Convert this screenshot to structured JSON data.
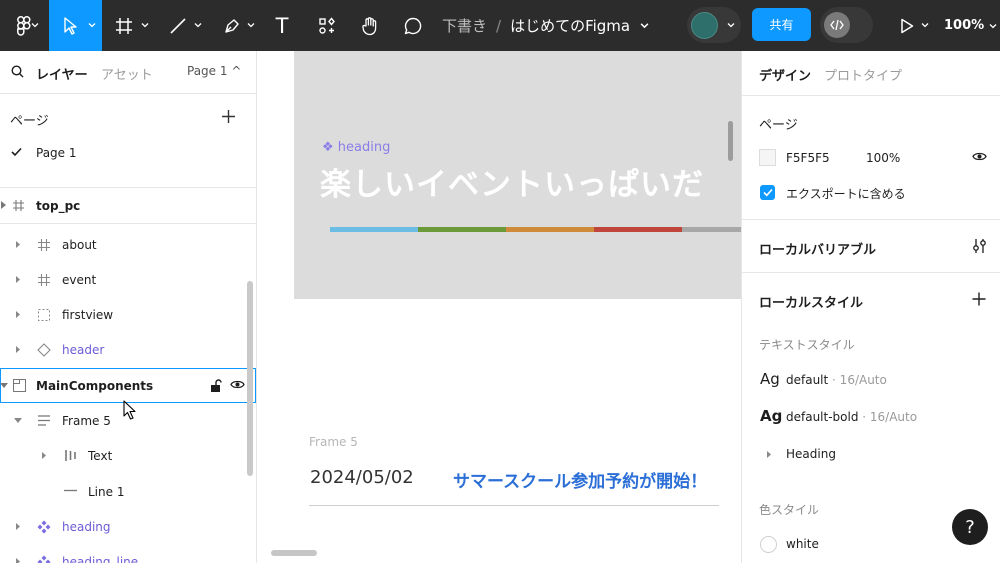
{
  "toolbar": {
    "breadcrumb_draft": "下書き",
    "breadcrumb_sep": "/",
    "file_name": "はじめてのFigma",
    "share_label": "共有",
    "zoom_label": "100%",
    "text_tool_glyph": "T"
  },
  "left_panel": {
    "tab_layers": "レイヤー",
    "tab_assets": "アセット",
    "page_select": "Page 1 ^",
    "pages_title": "ページ",
    "pages": [
      {
        "name": "Page 1"
      }
    ],
    "layers": [
      {
        "label": "top_pc"
      },
      {
        "label": "about"
      },
      {
        "label": "event"
      },
      {
        "label": "firstview"
      },
      {
        "label": "header"
      },
      {
        "label": "MainComponents"
      },
      {
        "label": "Frame 5"
      },
      {
        "label": "Text"
      },
      {
        "label": "Line 1"
      },
      {
        "label": "heading"
      },
      {
        "label": "heading_line"
      }
    ]
  },
  "canvas": {
    "hero_tag": "❖ heading",
    "hero_title": "楽しいイベントいっぱいだ",
    "hero_bar_colors": [
      "#6bbde3",
      "#6a9a3a",
      "#cf8a3a",
      "#c0453a",
      "#a8a8a8"
    ],
    "frame_label": "Frame 5",
    "news_date": "2024/05/02",
    "news_title": "サマースクール参加予約が開始！"
  },
  "right_panel": {
    "tab_design": "デザイン",
    "tab_prototype": "プロトタイプ",
    "page_heading": "ページ",
    "page_color_hex": "F5F5F5",
    "page_color_opacity": "100%",
    "export_label": "エクスポートに含める",
    "local_variables": "ローカルバリアブル",
    "local_styles": "ローカルスタイル",
    "text_styles_heading": "テキストスタイル",
    "text_styles": [
      {
        "ag": "Ag",
        "name": "default",
        "meta": " · 16/Auto"
      },
      {
        "ag": "Ag",
        "name": "default-bold",
        "meta": " · 16/Auto"
      }
    ],
    "heading_group": "Heading",
    "color_styles_heading": "色スタイル",
    "color_styles": [
      {
        "name": "white"
      }
    ],
    "help_label": "?"
  },
  "colors": {
    "accent": "#0d99ff",
    "toolbar_bg": "#2c2c2c",
    "component_purple": "#6b5cd6"
  }
}
